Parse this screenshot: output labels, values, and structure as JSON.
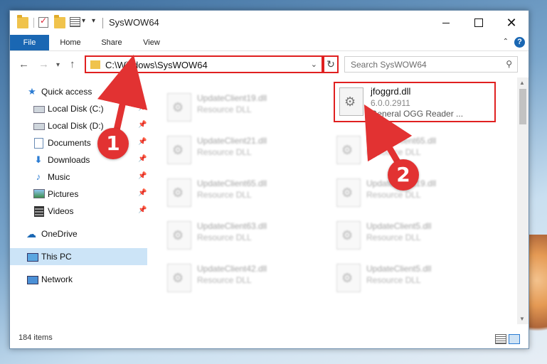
{
  "window": {
    "title": "SysWOW64"
  },
  "ribbon": {
    "tabs": [
      "File",
      "Home",
      "Share",
      "View"
    ],
    "help": "?"
  },
  "nav": {
    "address": "C:\\Windows\\SysWOW64",
    "search_placeholder": "Search SysWOW64"
  },
  "sidebar": {
    "items": [
      {
        "label": "Quick access",
        "icon": "star-icon"
      },
      {
        "label": "Local Disk (C:)",
        "icon": "disk-icon"
      },
      {
        "label": "Local Disk (D:)",
        "icon": "disk-icon"
      },
      {
        "label": "Documents",
        "icon": "documents-icon"
      },
      {
        "label": "Downloads",
        "icon": "downloads-icon"
      },
      {
        "label": "Music",
        "icon": "music-icon"
      },
      {
        "label": "Pictures",
        "icon": "pictures-icon"
      },
      {
        "label": "Videos",
        "icon": "videos-icon"
      },
      {
        "label": "OneDrive",
        "icon": "onedrive-icon"
      },
      {
        "label": "This PC",
        "icon": "this-pc-icon"
      },
      {
        "label": "Network",
        "icon": "network-icon"
      }
    ]
  },
  "files": {
    "highlight": {
      "name": "jfoggrd.dll",
      "version": "6.0.0.2911",
      "desc": "General OGG Reader ..."
    },
    "left": [
      {
        "name": "UpdateClient19.dll",
        "type": "Resource DLL"
      },
      {
        "name": "UpdateClient21.dll",
        "type": "Resource DLL"
      },
      {
        "name": "UpdateClient65.dll",
        "type": "Resource DLL"
      },
      {
        "name": "UpdateClient63.dll",
        "type": "Resource DLL"
      },
      {
        "name": "UpdateClient42.dll",
        "type": "Resource DLL"
      }
    ],
    "right": [
      {
        "name": "UpdateClient65.dll",
        "type": "Resource DLL"
      },
      {
        "name": "UpdateClient19.dll",
        "type": "Resource DLL"
      },
      {
        "name": "UpdateClient5.dll",
        "type": "Resource DLL"
      },
      {
        "name": "UpdateClient5.dll",
        "type": "Resource DLL"
      }
    ]
  },
  "status": {
    "count": "184 items"
  },
  "annotations": {
    "step1": "1",
    "step2": "2",
    "color": "#e23232"
  }
}
